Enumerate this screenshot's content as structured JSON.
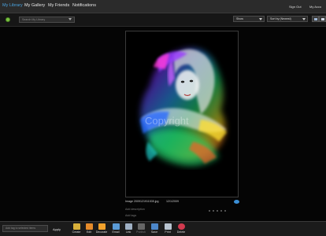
{
  "topnav": {
    "items": [
      {
        "label": "My Library",
        "active": true
      },
      {
        "label": "My Gallery",
        "active": false
      },
      {
        "label": "My Friends",
        "active": false
      },
      {
        "label": "Notifications",
        "active": false
      }
    ],
    "sign_out": "Sign Out",
    "my_account": "My Acco"
  },
  "toolbar": {
    "search_placeholder": "Search My Library",
    "show_select": "Show",
    "sort_select": "Sort by (Newest)",
    "refresh_icon": "refresh-icon",
    "view_icons": [
      "grid-view-icon",
      "single-view-icon"
    ]
  },
  "photo": {
    "filename": "Image 2009121911535.jpg",
    "date": "12/1/2009",
    "add_description": "Add description",
    "add_tags": "Add tags",
    "watermark": "Copyright"
  },
  "bottombar": {
    "tag_placeholder": "Add tag to selected items",
    "apply": "Apply",
    "tools": [
      {
        "label": "Create",
        "icon": "create-icon",
        "color": "#d8b03a"
      },
      {
        "label": "Edit",
        "icon": "edit-icon",
        "color": "#e58b2a"
      },
      {
        "label": "Decorate",
        "icon": "decorate-icon",
        "color": "#f2a22c"
      },
      {
        "label": "Email",
        "icon": "email-icon",
        "color": "#5a9ad6"
      },
      {
        "label": "Link",
        "icon": "link-icon",
        "color": "#9fb0c4"
      },
      {
        "label": "Publish",
        "icon": "publish-icon",
        "color": "#666666"
      },
      {
        "label": "Save",
        "icon": "save-icon",
        "color": "#4c86c8"
      },
      {
        "label": "Print",
        "icon": "print-icon",
        "color": "#b8c4d0"
      },
      {
        "label": "Delete",
        "icon": "delete-icon",
        "color": "#d23a4f"
      }
    ]
  },
  "colors": {
    "accent": "#4aa3df",
    "background": "#050505",
    "topbar": "#2b2b2b"
  }
}
